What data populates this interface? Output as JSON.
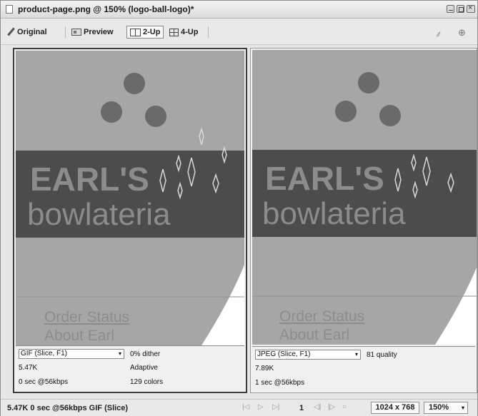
{
  "window": {
    "title": "product-page.png @ 150% (logo-ball-logo)*"
  },
  "toolbar": {
    "tabs": [
      {
        "label": "Original",
        "icon": "pencil-icon"
      },
      {
        "label": "Preview",
        "icon": "preview-icon"
      },
      {
        "label": "2-Up",
        "icon": "two-up-icon",
        "active": true
      },
      {
        "label": "4-Up",
        "icon": "four-up-icon"
      }
    ]
  },
  "artwork": {
    "brand_line1": "EARL'S",
    "brand_line2": "bowlateria",
    "link1": "Order Status",
    "link2": "About Earl",
    "colors": {
      "ball": "#a6a6a6",
      "band": "#4c4c4c",
      "text": "#8c8c8c",
      "holes": "#6a6a6a",
      "sparkle": "#d8d8d8"
    }
  },
  "panes": [
    {
      "format": "GIF (Slice, F1)",
      "option": "0% dither",
      "size": "5.47K",
      "palette": "Adaptive",
      "speed": "0 sec @56kbps",
      "colors": "129 colors"
    },
    {
      "format": "JPEG (Slice, F1)",
      "option": "81 quality",
      "size": "7.89K",
      "palette": "",
      "speed": "1 sec @56kbps",
      "colors": ""
    }
  ],
  "status": {
    "text": "5.47K 0 sec @56kbps GIF (Slice)",
    "frame": "1",
    "dimensions": "1024 x 768",
    "zoom": "150%"
  }
}
